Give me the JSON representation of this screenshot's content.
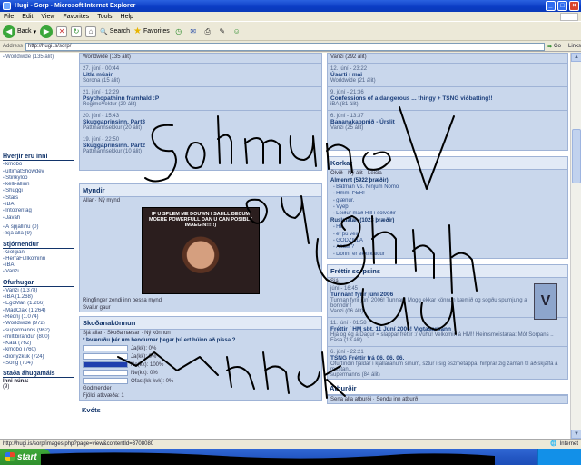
{
  "window": {
    "title": "Hugi - Sorp - Microsoft Internet Explorer",
    "controls": [
      "_",
      "□",
      "×"
    ]
  },
  "menu": [
    "File",
    "Edit",
    "View",
    "Favorites",
    "Tools",
    "Help"
  ],
  "toolbar": {
    "back": "Back",
    "search": "Search",
    "favorites": "Favorites"
  },
  "address": {
    "label": "Address",
    "url": "http://hugi.is/sorp/",
    "go": "Go",
    "links": "Links"
  },
  "left": {
    "top_items": [
      "Worldwide (135 álit)"
    ],
    "section1_title": "Hverjir eru inni",
    "section1_items": [
      "kmobo",
      "ultimatShowdev",
      "Stinkyloo",
      "kelli-allinn",
      "Shuggi",
      "Stars",
      "iBA",
      "Intotrenfag",
      "Javah"
    ],
    "online_counts": [
      "Á spjallinu (0)",
      "Sjá alla (9)"
    ],
    "section2_title": "Stjórnendur",
    "section2_items": [
      "Golgian",
      "HerraFullkominn",
      "iBA",
      "Vanzi"
    ],
    "section3_title": "Ofurhugar",
    "section3_items": [
      "Vanzi (1.378)",
      "iBA (1.268)",
      "EgoMan (1.266)",
      "MadClax (1.264)",
      "Rednj (1.074)",
      "Worldwide (972)",
      "supermanns (962)",
      "miltibirandur (800)",
      "Kata (762)",
      "kmobo (760)",
      "dionyzkuk (724)",
      "Song (704)"
    ],
    "section4_title": "Staða áhugamáls",
    "section4_items": [
      "Inni núna:",
      "(9)"
    ]
  },
  "middle": {
    "top_meta": "Worldwide (135 álit)",
    "entries": [
      {
        "date": "27. júní - 00:44",
        "title": "Litla músin",
        "meta": "Sorona (15 álit)"
      },
      {
        "date": "21. júní - 12:29",
        "title": "Psychopathinn framhald :P",
        "meta": "RegimeVektur (20 álit)"
      },
      {
        "date": "20. júní - 15:43",
        "title": "Skuggaprinsinn. Part3",
        "meta": "Pattmannsekkur (20 álit)"
      },
      {
        "date": "19. júní - 22:50",
        "title": "Skuggaprinsinn. Part2",
        "meta": "Pattmannsekkur (10 álit)"
      }
    ],
    "myndir_title": "Myndir",
    "myndir_tabs": [
      "Allar",
      "Ný mynd"
    ],
    "photo_caption": "IF U SPLEM ME DOUWN I SAHLL BECUM MOERE POWERFULL DAN U CAN POSIBLY IMAEGIN!!!!!)",
    "photo_description": "Ringfinger zendi inn þessa mynd",
    "photo_link": "Svalur gaur",
    "poll_title": "Skoðanakönnun",
    "poll_tabs": [
      "Sjá allar",
      "Skoða næsar",
      "Ný könnun"
    ],
    "poll_question": "* Þværuðu þér um hendurnar þegar þú ert búinn að pissa ?",
    "poll_options": [
      {
        "label": "Ja(kk): 0%",
        "value": 0
      },
      {
        "label": "Ja(kk): 0%",
        "value": 0
      },
      {
        "label": "Ne(kk): 100%",
        "value": 100
      },
      {
        "label": "Ne(kk): 0%",
        "value": 0
      },
      {
        "label": "Ofast(kk-kvk): 0%",
        "value": 0
      }
    ],
    "poll_footer": [
      "Godmender",
      "Fjöldi atkvæða: 1"
    ],
    "kvotr_title": "Kvóts"
  },
  "right": {
    "top_meta": "Vanzi (292 álit)",
    "entries": [
      {
        "date": "12. júní - 23:22",
        "title": "Úsarti í mai",
        "meta": "Worldwide (21 álit)"
      },
      {
        "date": "9. júní - 21:36",
        "title": "Confessions of a dangerous ... thingy + TSNG viðbatting!!",
        "meta": "iBA (81 álit)"
      },
      {
        "date": "6. júní - 13:37",
        "title": "Bananakappnið - Úrslit",
        "meta": "Vanzi (25 álit)"
      }
    ],
    "korkar_title": "Korkar",
    "korkar_tabs": [
      "Ölvið",
      "Ný álit",
      "Leicia"
    ],
    "korkar_sub1": "Almennt (5922 þræðir)",
    "korkar_items1": [
      "Batman Vs. Ninjum Nomo",
      "Hmm. ÞÉR!",
      "glænur.",
      "Vyeþ",
      "Leiður mað Hill í sólveðir"
    ],
    "korkar_sub2": "Ruslafatan (1023 þræðir)",
    "korkar_items2": [
      "He",
      "ef þú veiir",
      "GODZILLA",
      "Ariaw ?",
      "Dónnr er ekki kaldur"
    ],
    "frettir_title": "Fréttir sorpsins",
    "frettir_tabs": [
      "Sjá"
    ],
    "news": [
      {
        "date": "júní - 16:45",
        "title": "Tunnan! fyrir júní 2006",
        "body": "Tunnan fyrir júní 2006! Tunnan! Mogg ekkar könnun kæmið og sogðu spurnjung a bonndir !",
        "meta": "Vanzi (06 álit)"
      },
      {
        "date": "11. júní - 01:58",
        "title": "Fréttir í HM sbt, 11 Júní 2006! Vígtasarbann",
        "body": "Hjá og ég á Dagur = slappar fréttir :/ Vúhú! Velkomin á HM!! Heimsmeistaraa: Mót Sorpans ..",
        "meta": "Fasa (13 álit)"
      },
      {
        "date": "6. júní - 22:21",
        "title": "TSNG Fréttir frá 06. 06. 06.",
        "body": "Ofurtíndin fjaldar í kjallaranum sínum, sztur í sig eszmetappa. hinprar zig zaman til að skjálfa a mestan..",
        "meta": "supermanns (84 álit)"
      }
    ],
    "atburdir_title": "Atburðir",
    "atburdir_tabs": [
      "Sena alla atburði",
      "Sendu inn atburð"
    ]
  },
  "status": {
    "url": "http://hugi.is/sorp/images.php?page=view&contentId=3708080",
    "zone": "Internet"
  },
  "taskbar": {
    "start": "start",
    "clock": ""
  }
}
